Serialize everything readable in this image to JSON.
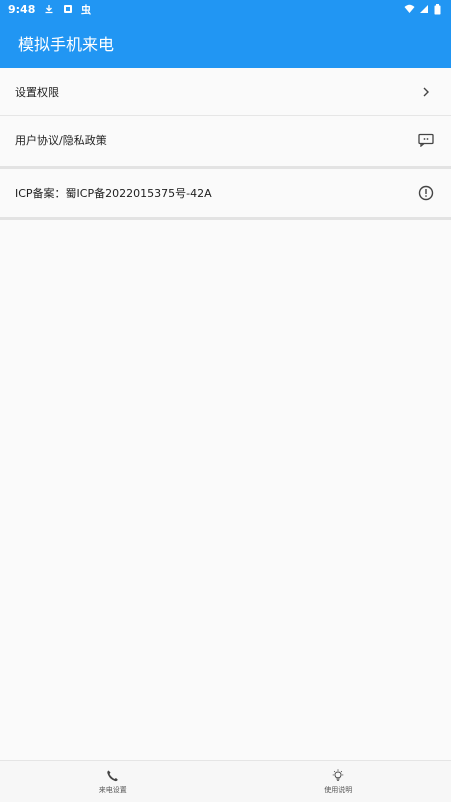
{
  "status_bar": {
    "time": "9:48",
    "left_icons": [
      "download-icon",
      "image-icon",
      "bug-icon"
    ],
    "right_icons": [
      "wifi-icon",
      "signal-icon",
      "battery-icon"
    ]
  },
  "app_bar": {
    "title": "模拟手机来电"
  },
  "settings": {
    "items": [
      {
        "label": "设置权限",
        "icon": "chevron-right-icon"
      },
      {
        "label": "用户协议/隐私政策",
        "icon": "message-icon"
      }
    ]
  },
  "icp": {
    "label": "ICP备案：蜀ICP备2022015375号-42A",
    "icon": "info-alert-icon"
  },
  "bottom_nav": {
    "items": [
      {
        "label": "来电设置",
        "icon": "phone-icon"
      },
      {
        "label": "使用说明",
        "icon": "lightbulb-icon"
      }
    ]
  },
  "colors": {
    "primary": "#2196f3",
    "background": "#fafafa",
    "divider": "#e3e3e3"
  }
}
